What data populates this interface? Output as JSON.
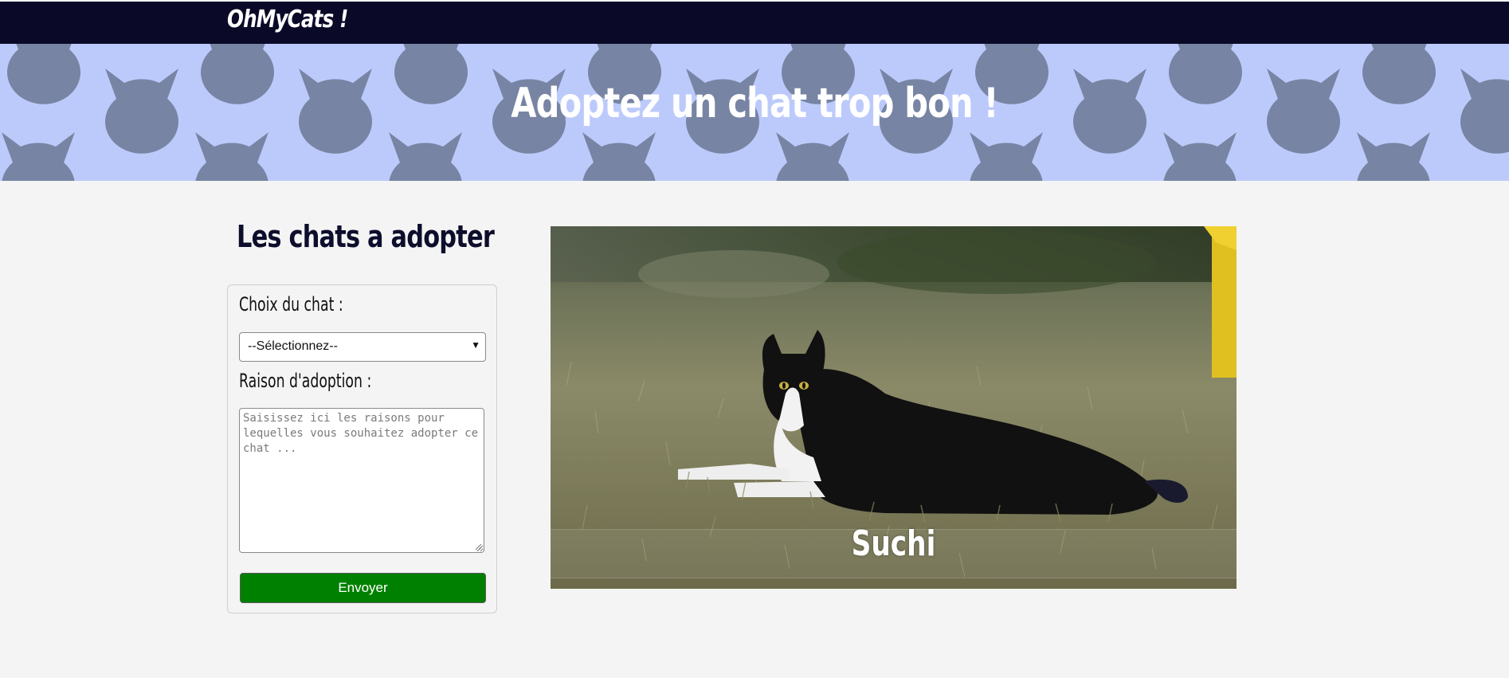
{
  "header": {
    "logo_text": "OhMyCats !"
  },
  "banner": {
    "title": "Adoptez un chat trop bon !",
    "background_color": "#bccafb",
    "pattern_color": "#7784a3",
    "pattern_icon": "cat-head-icon"
  },
  "main": {
    "section_title": "Les chats a adopter",
    "form": {
      "cat_label": "Choix du chat :",
      "cat_select_value": "--Sélectionnez--",
      "reason_label": "Raison d'adoption :",
      "reason_placeholder": "Saisissez ici les raisons pour lequelles vous souhaitez adopter ce chat ...",
      "submit_label": "Envoyer",
      "submit_color": "#008000"
    },
    "featured_cat": {
      "name": "Suchi"
    }
  },
  "colors": {
    "topbar": "#0a0a28",
    "page_background": "#f4f4f4",
    "title_text": "#0d0d2c"
  }
}
